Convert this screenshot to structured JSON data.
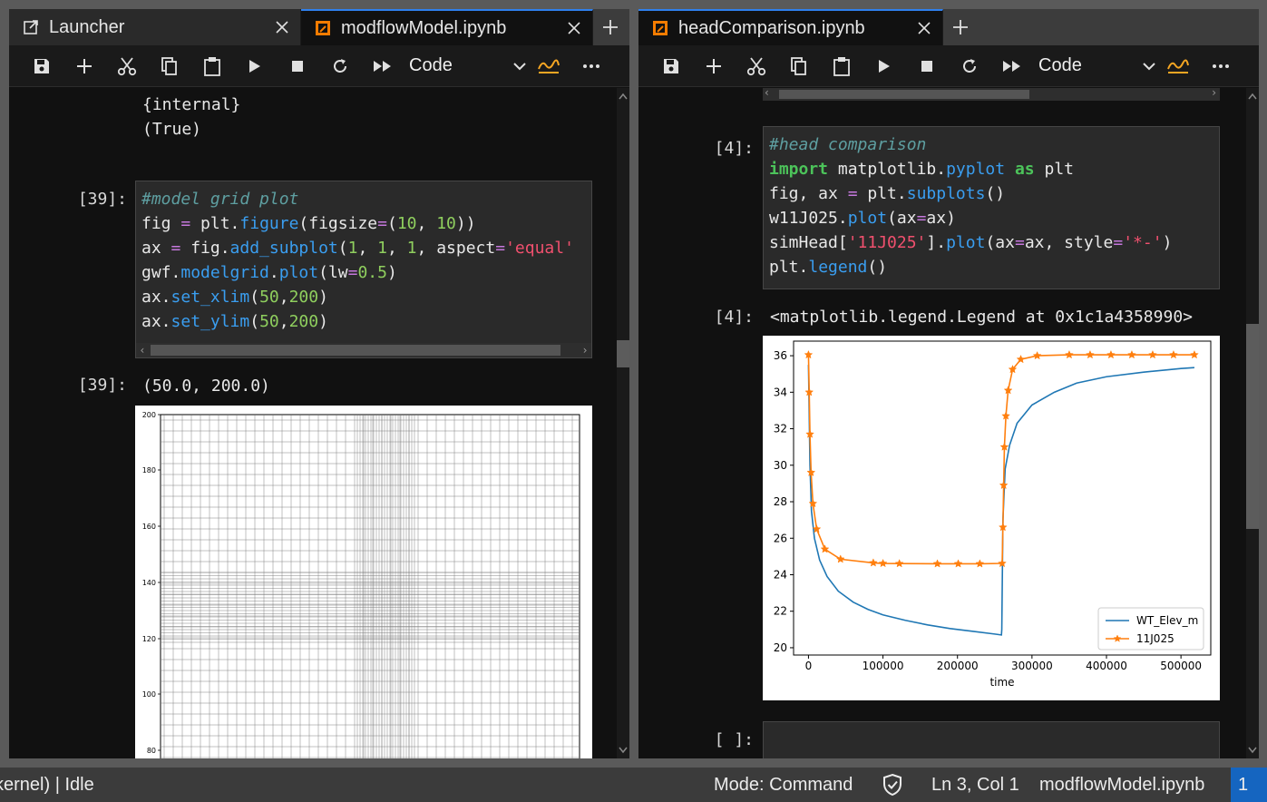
{
  "left": {
    "tabs": [
      {
        "label": "Launcher",
        "icon": "launcher-icon",
        "active": false
      },
      {
        "label": "modflowModel.ipynb",
        "icon": "notebook-icon",
        "active": true
      }
    ],
    "cell_type": "Code",
    "top_output": [
      "{internal}",
      "(True)"
    ],
    "cell39": {
      "in_prompt": "[39]:",
      "out_prompt": "[39]:",
      "output": "(50.0, 200.0)"
    },
    "plot_ticks": [
      "200",
      "180",
      "160",
      "140",
      "120",
      "100",
      "80"
    ]
  },
  "right": {
    "tabs": [
      {
        "label": "headComparison.ipynb",
        "icon": "notebook-icon",
        "active": true
      }
    ],
    "cell_type": "Code",
    "cell4": {
      "in_prompt": "[4]:",
      "out_prompt": "[4]:",
      "output": "<matplotlib.legend.Legend at 0x1c1a4358990>"
    },
    "empty_prompt": "[ ]:"
  },
  "colors": {
    "accent": "#2f80ed",
    "series1": "#1f77b4",
    "series2": "#ff7f0e",
    "notebook_icon": "#f57c00"
  },
  "chart_data": {
    "type": "line",
    "title": "",
    "xlabel": "time",
    "ylabel": "",
    "xlim": [
      -20000,
      540000
    ],
    "ylim": [
      19.6,
      36.8
    ],
    "x_ticks": [
      0,
      100000,
      200000,
      300000,
      400000,
      500000
    ],
    "x_tick_labels": [
      "0",
      "100000",
      "200000",
      "300000",
      "400000",
      "500000"
    ],
    "y_ticks": [
      20,
      22,
      24,
      26,
      28,
      30,
      32,
      34,
      36
    ],
    "y_tick_labels": [
      "20",
      "22",
      "24",
      "26",
      "28",
      "30",
      "32",
      "34",
      "36"
    ],
    "legend_position": "lower-right",
    "series": [
      {
        "name": "WT_Elev_m",
        "marker": "none",
        "x": [
          0,
          2000,
          4000,
          8000,
          15000,
          25000,
          40000,
          60000,
          80000,
          100000,
          130000,
          160000,
          190000,
          220000,
          250000,
          259000,
          259500,
          261000,
          264000,
          270000,
          280000,
          300000,
          330000,
          360000,
          400000,
          450000,
          500000,
          518000
        ],
        "y": [
          35.5,
          30.0,
          27.5,
          26.0,
          24.8,
          23.9,
          23.1,
          22.5,
          22.1,
          21.8,
          21.5,
          21.25,
          21.05,
          20.9,
          20.75,
          20.7,
          21.0,
          27.0,
          29.8,
          31.1,
          32.3,
          33.3,
          34.0,
          34.5,
          34.85,
          35.1,
          35.3,
          35.35
        ]
      },
      {
        "name": "11J025",
        "marker": "star",
        "x": [
          0,
          1000,
          2000,
          3500,
          6000,
          11000,
          22000,
          43000,
          87000,
          100000,
          122000,
          173000,
          201000,
          230000,
          260000,
          261000,
          262000,
          263000,
          265000,
          268000,
          274000,
          285000,
          307000,
          350000,
          378000,
          406000,
          434000,
          462000,
          490000,
          518000
        ],
        "y": [
          36.05,
          34.0,
          31.7,
          29.6,
          27.9,
          26.5,
          25.4,
          24.85,
          24.65,
          24.62,
          24.61,
          24.6,
          24.6,
          24.6,
          24.62,
          26.6,
          28.9,
          31.0,
          32.7,
          34.1,
          35.25,
          35.8,
          36.0,
          36.05,
          36.05,
          36.05,
          36.05,
          36.05,
          36.05,
          36.05
        ]
      }
    ]
  },
  "status": {
    "kernel": "kernel) | Idle",
    "mode": "Mode: Command",
    "position": "Ln 3, Col 1",
    "file": "modflowModel.ipynb",
    "badge": "1"
  }
}
